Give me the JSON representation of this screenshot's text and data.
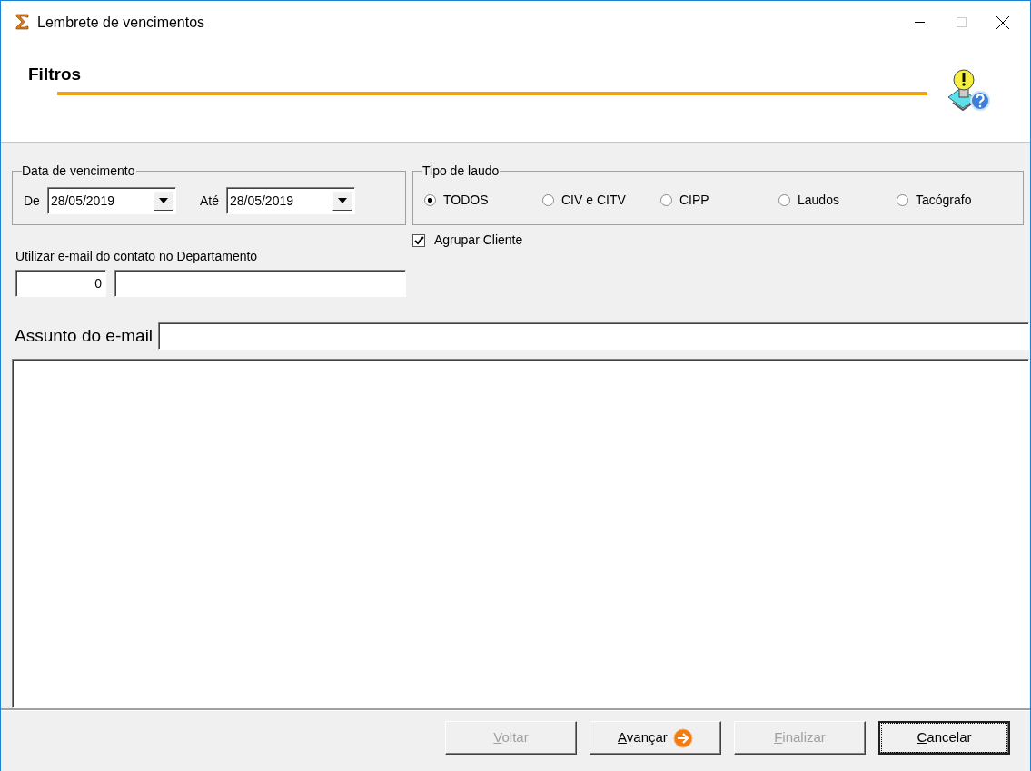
{
  "window": {
    "title": "Lembrete de vencimentos"
  },
  "header": {
    "title": "Filtros"
  },
  "due_date": {
    "legend": "Data de vencimento",
    "from_label": "De",
    "from_value": "28/05/2019",
    "to_label": "Até",
    "to_value": "28/05/2019"
  },
  "report_type": {
    "legend": "Tipo de laudo",
    "options": [
      {
        "label": "TODOS",
        "selected": true
      },
      {
        "label": "CIV e CITV",
        "selected": false
      },
      {
        "label": "CIPP",
        "selected": false
      },
      {
        "label": "Laudos",
        "selected": false
      },
      {
        "label": "Tacógrafo",
        "selected": false
      }
    ]
  },
  "group_client": {
    "label": "Agrupar Cliente",
    "checked": true
  },
  "department_email": {
    "label": "Utilizar e-mail do contato no Departamento",
    "code": "0"
  },
  "subject": {
    "label": "Assunto do e-mail"
  },
  "buttons": [
    {
      "label": "Voltar",
      "disabled": true,
      "focused": false,
      "arrow": false
    },
    {
      "label": "Avançar",
      "disabled": false,
      "focused": false,
      "arrow": true
    },
    {
      "label": "Finalizar",
      "disabled": true,
      "focused": false,
      "arrow": false
    },
    {
      "label": "Cancelar",
      "disabled": false,
      "focused": true,
      "arrow": false
    }
  ]
}
